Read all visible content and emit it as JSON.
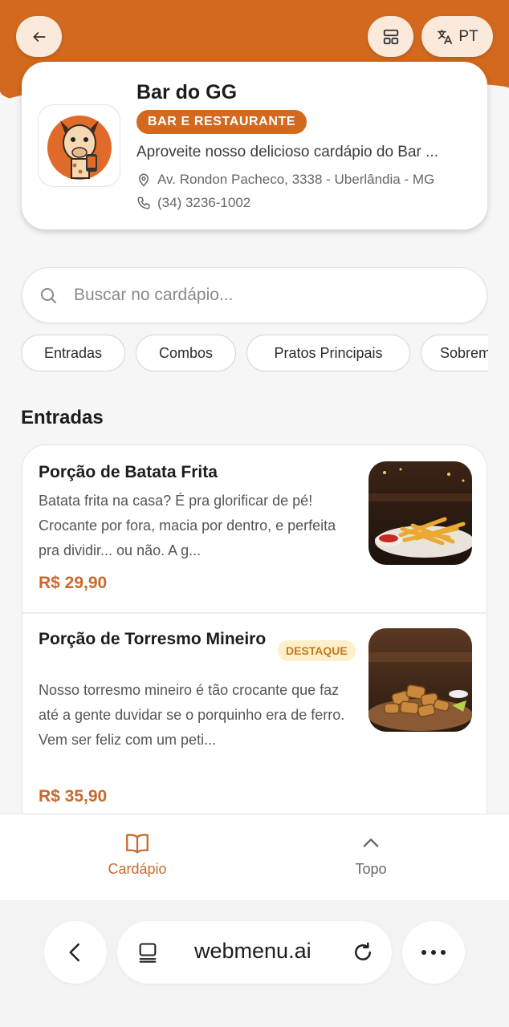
{
  "colors": {
    "brand": "#d2691e",
    "price": "#c9692b",
    "badge_bg": "#fdefc9",
    "badge_text": "#c57a1a"
  },
  "header": {
    "lang_label": "PT",
    "icons": {
      "back": "arrow-left-icon",
      "layout": "layout-grid-icon",
      "lang": "translate-icon"
    }
  },
  "business": {
    "name": "Bar do GG",
    "category": "BAR E RESTAURANTE",
    "description": "Aproveite nosso delicioso cardápio do Bar ...",
    "address": "Av. Rondon Pacheco, 3338 - Uberlândia - MG",
    "phone": "(34) 3236-1002"
  },
  "search": {
    "placeholder": "Buscar no cardápio..."
  },
  "categories": [
    "Entradas",
    "Combos",
    "Pratos Principais",
    "Sobremesas"
  ],
  "section": {
    "title": "Entradas"
  },
  "items": [
    {
      "name": "Porção de Batata Frita",
      "description": "Batata frita na casa? É pra glorificar de pé! Crocante por fora, macia por dentro, e perfeita pra dividir... ou não. A g...",
      "price": "R$ 29,90"
    },
    {
      "name": "Porção de Torresmo Mineiro",
      "badge": "DESTAQUE",
      "description": "Nosso torresmo mineiro é tão crocante que faz até a gente duvidar se o porquinho era de ferro. Vem ser feliz com um peti...",
      "price": "R$ 35,90"
    }
  ],
  "bottom_nav": {
    "menu_label": "Cardápio",
    "top_label": "Topo"
  },
  "browser": {
    "url": "webmenu.ai"
  }
}
